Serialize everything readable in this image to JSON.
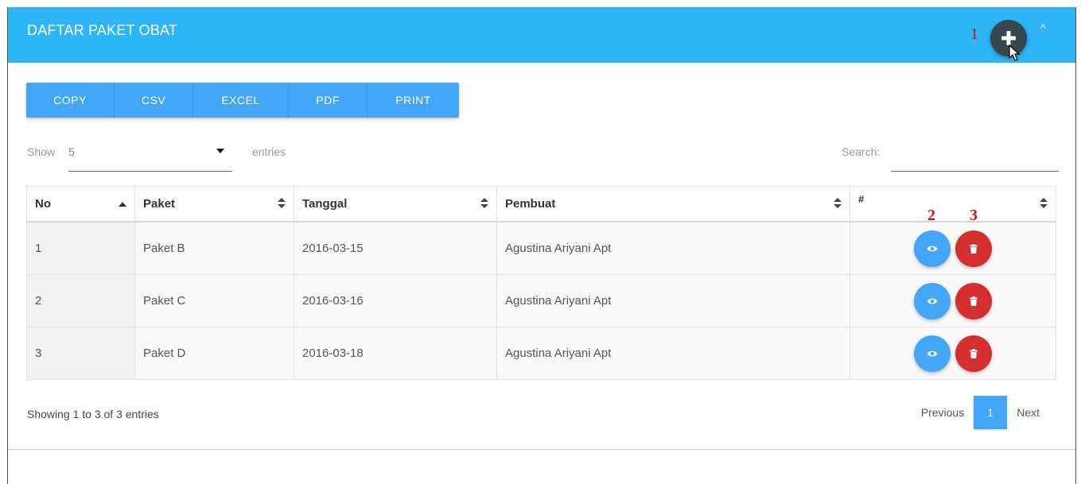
{
  "header": {
    "title": "DAFTAR PAKET OBAT",
    "collapse_glyph": "^",
    "add_icon": "plus-icon",
    "color": "#2db5f5"
  },
  "annotations": [
    "1",
    "2",
    "3"
  ],
  "export_buttons": [
    "COPY",
    "CSV",
    "EXCEL",
    "PDF",
    "PRINT"
  ],
  "length": {
    "show_label": "Show",
    "value": "5",
    "entries_label": "entries"
  },
  "search": {
    "label": "Search:",
    "value": ""
  },
  "table": {
    "columns": [
      "No",
      "Paket",
      "Tanggal",
      "Pembuat",
      "#"
    ],
    "rows": [
      {
        "no": "1",
        "paket": "Paket B",
        "tanggal": "2016-03-15",
        "pembuat": "Agustina Ariyani Apt"
      },
      {
        "no": "2",
        "paket": "Paket C",
        "tanggal": "2016-03-16",
        "pembuat": "Agustina Ariyani Apt"
      },
      {
        "no": "3",
        "paket": "Paket D",
        "tanggal": "2016-03-18",
        "pembuat": "Agustina Ariyani Apt"
      }
    ],
    "action_icons": [
      "eye-icon",
      "trash-icon"
    ]
  },
  "footer": {
    "info": "Showing 1 to 3 of 3 entries",
    "previous": "Previous",
    "page": "1",
    "next": "Next"
  },
  "colors": {
    "primary": "#42a5f5",
    "danger": "#d32f2f",
    "fab": "#37474f"
  }
}
